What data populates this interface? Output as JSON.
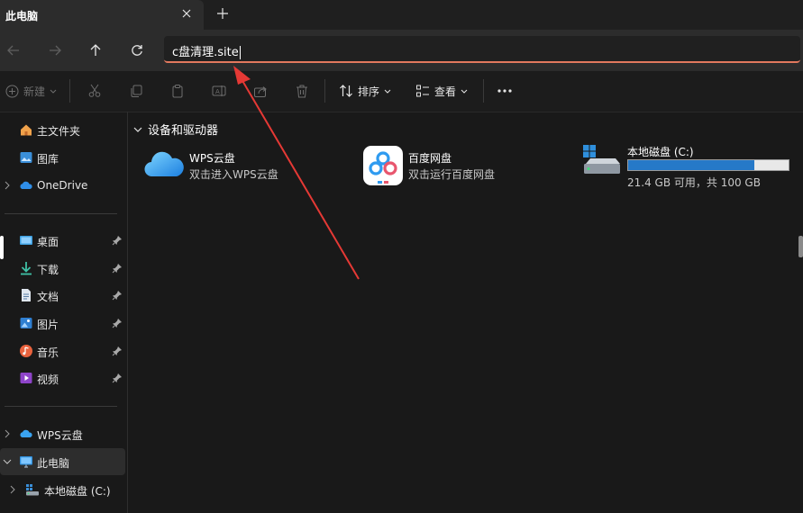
{
  "tab": {
    "title": "此电脑"
  },
  "address": {
    "value": "c盘清理.site"
  },
  "toolbar": {
    "new_label": "新建",
    "sort_label": "排序",
    "view_label": "查看"
  },
  "sidebar": {
    "quick": [
      {
        "label": "主文件夹",
        "icon": "home-icon"
      },
      {
        "label": "图库",
        "icon": "gallery-icon"
      },
      {
        "label": "OneDrive",
        "icon": "onedrive-icon"
      }
    ],
    "pinned": [
      {
        "label": "桌面",
        "icon": "desktop-icon"
      },
      {
        "label": "下载",
        "icon": "download-icon"
      },
      {
        "label": "文档",
        "icon": "document-icon"
      },
      {
        "label": "图片",
        "icon": "pictures-icon"
      },
      {
        "label": "音乐",
        "icon": "music-icon"
      },
      {
        "label": "视频",
        "icon": "video-icon"
      }
    ],
    "bottom": [
      {
        "label": "WPS云盘",
        "icon": "wps-cloud-icon"
      },
      {
        "label": "此电脑",
        "icon": "this-pc-icon"
      },
      {
        "label": "本地磁盘 (C:)",
        "icon": "local-disk-icon"
      }
    ]
  },
  "main": {
    "section_title": "设备和驱动器",
    "tiles": [
      {
        "name": "WPS云盘",
        "desc": "双击进入WPS云盘"
      },
      {
        "name": "百度网盘",
        "desc": "双击运行百度网盘"
      }
    ],
    "drive": {
      "name": "本地磁盘 (C:)",
      "desc": "21.4 GB 可用，共 100 GB",
      "used_fraction": 0.786
    }
  },
  "colors": {
    "accent": "#e2795e",
    "drive_fill": "#2679c8",
    "arrow": "#e53935"
  }
}
